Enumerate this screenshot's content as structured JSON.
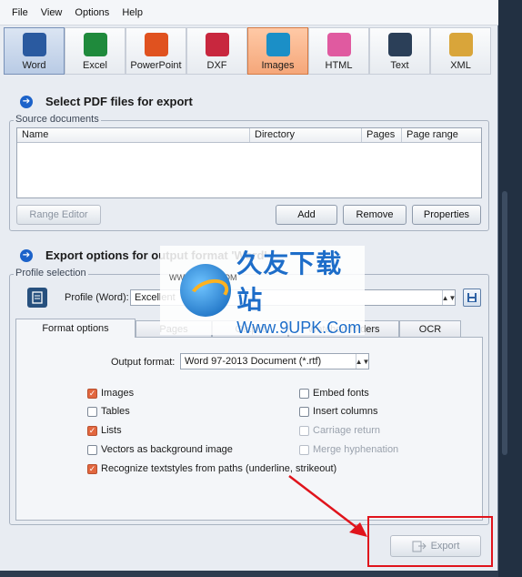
{
  "menu": [
    "File",
    "View",
    "Options",
    "Help"
  ],
  "toolbar": [
    {
      "label": "Word",
      "icon": "word-icon",
      "color": "#2a5aa0",
      "glyph": "W",
      "state": "active-word"
    },
    {
      "label": "Excel",
      "icon": "excel-icon",
      "color": "#1f8a3c",
      "glyph": "X",
      "state": ""
    },
    {
      "label": "PowerPoint",
      "icon": "powerpoint-icon",
      "color": "#e0521f",
      "glyph": "P",
      "state": ""
    },
    {
      "label": "DXF",
      "icon": "dxf-icon",
      "color": "#c8273e",
      "glyph": "D",
      "state": ""
    },
    {
      "label": "Images",
      "icon": "images-icon",
      "color": "#1b8fc7",
      "glyph": "I",
      "state": "active-img"
    },
    {
      "label": "HTML",
      "icon": "html-icon",
      "color": "#e05aa0",
      "glyph": "H",
      "state": ""
    },
    {
      "label": "Text",
      "icon": "text-icon",
      "color": "#2b3f58",
      "glyph": "T",
      "state": ""
    },
    {
      "label": "XML",
      "icon": "xml-icon",
      "color": "#d9a53a",
      "glyph": "M",
      "state": ""
    }
  ],
  "select_section": {
    "title": "Select PDF files for export",
    "group": "Source documents",
    "columns": [
      "Name",
      "Directory",
      "Pages",
      "Page range"
    ],
    "buttons": {
      "range_editor": "Range Editor",
      "add": "Add",
      "remove": "Remove",
      "properties": "Properties"
    }
  },
  "export_section": {
    "title": "Export options for output format 'Word'",
    "group": "Profile selection",
    "profile_label": "Profile (Word):",
    "profile_value": "Excellent",
    "tabs": [
      "Format options",
      "Pages",
      "Output",
      "Watched folders",
      "OCR"
    ],
    "output_format_label": "Output format:",
    "output_format_value": "Word 97-2013 Document (*.rtf)",
    "options_left": [
      {
        "label": "Images",
        "checked": true,
        "disabled": false
      },
      {
        "label": "Tables",
        "checked": false,
        "disabled": false
      },
      {
        "label": "Lists",
        "checked": true,
        "disabled": false
      },
      {
        "label": "Vectors as background image",
        "checked": false,
        "disabled": false
      },
      {
        "label": "Recognize textstyles from paths (underline, strikeout)",
        "checked": true,
        "disabled": false
      }
    ],
    "options_right": [
      {
        "label": "Embed fonts",
        "checked": false,
        "disabled": false
      },
      {
        "label": "Insert columns",
        "checked": false,
        "disabled": false
      },
      {
        "label": "Carriage return",
        "checked": false,
        "disabled": true
      },
      {
        "label": "Merge hyphenation",
        "checked": false,
        "disabled": true
      }
    ],
    "export_button": "Export"
  },
  "watermark": {
    "cn": "久友下载站",
    "url": "Www.9UPK.Com",
    "small": "WWW.9UPK.COM"
  },
  "colors": {
    "accent": "#1c62c9",
    "check": "#e2673f",
    "annotation": "#e0141c"
  }
}
